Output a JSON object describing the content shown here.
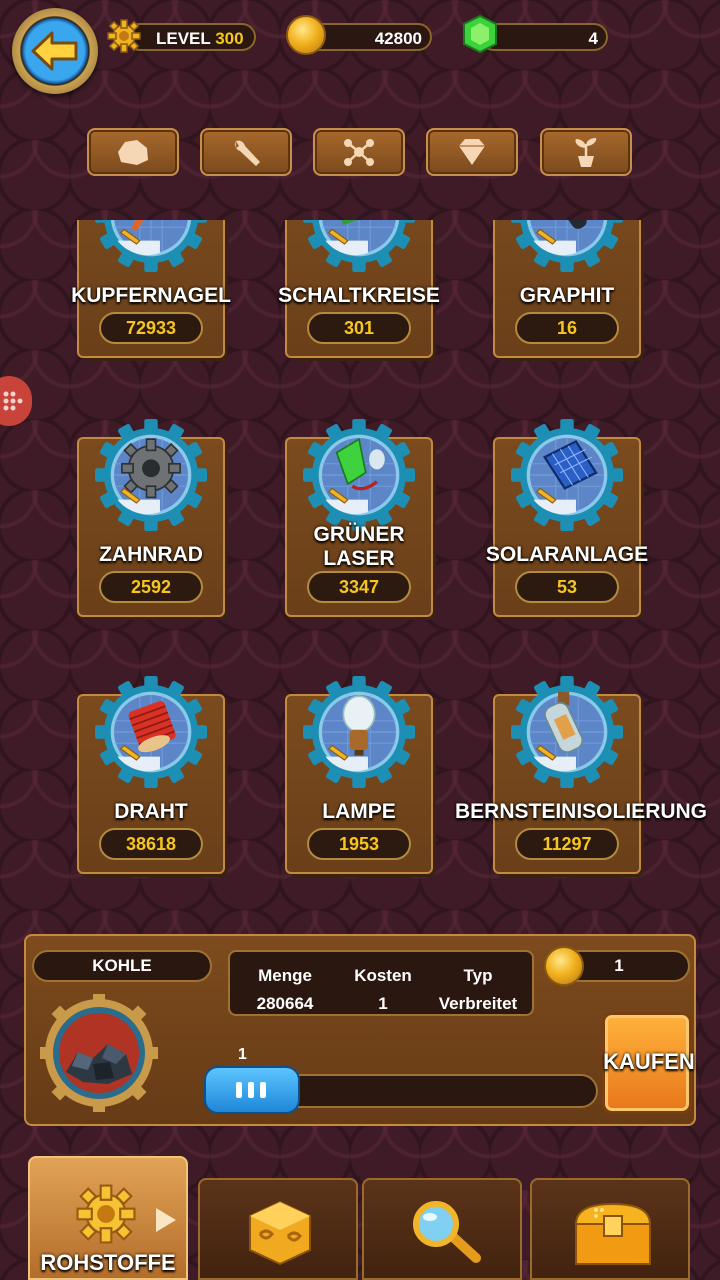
{
  "header": {
    "level_label": "LEVEL",
    "level_value": "300",
    "coins": "42800",
    "gems": "4"
  },
  "categories": [
    {
      "icon": "rock-icon"
    },
    {
      "icon": "wrench-icon"
    },
    {
      "icon": "molecule-icon"
    },
    {
      "icon": "diamond-icon"
    },
    {
      "icon": "plant-icon"
    }
  ],
  "items": [
    {
      "name": "KUPFERNAGEL",
      "count": "72933",
      "icon": "copper-nail-icon"
    },
    {
      "name": "SCHALTKREISE",
      "count": "301",
      "icon": "circuit-board-icon"
    },
    {
      "name": "GRAPHIT",
      "count": "16",
      "icon": "graphite-icon"
    },
    {
      "name": "ZAHNRAD",
      "count": "2592",
      "icon": "gear-wheel-icon"
    },
    {
      "name": "GRÜNER LASER",
      "count": "3347",
      "icon": "green-laser-icon"
    },
    {
      "name": "SOLARANLAGE",
      "count": "53",
      "icon": "solar-panel-icon"
    },
    {
      "name": "DRAHT",
      "count": "38618",
      "icon": "wire-spool-icon"
    },
    {
      "name": "LAMPE",
      "count": "1953",
      "icon": "lamp-icon"
    },
    {
      "name": "BERNSTEINISOLIERUNG",
      "count": "11297",
      "icon": "amber-bottle-icon"
    }
  ],
  "panel": {
    "resource_name": "KOHLE",
    "stats": {
      "amount_label": "Menge",
      "amount_value": "280664",
      "cost_label": "Kosten",
      "cost_value": "1",
      "type_label": "Typ",
      "type_value": "Verbreitet"
    },
    "price": "1",
    "quantity": "1",
    "buy_label": "KAUFEN"
  },
  "nav": {
    "tabs": [
      {
        "label": "ROHSTOFFE",
        "icon": "gear-icon",
        "active": true
      },
      {
        "label": "",
        "icon": "dice-icon"
      },
      {
        "label": "",
        "icon": "magnifier-icon"
      },
      {
        "label": "",
        "icon": "treasure-chest-icon"
      }
    ]
  },
  "colors": {
    "background": "#3e1b27",
    "card": "#6e4219",
    "count_text": "#f7c61d",
    "buy_button": "#f08a22",
    "slider": "#2b95e6"
  }
}
